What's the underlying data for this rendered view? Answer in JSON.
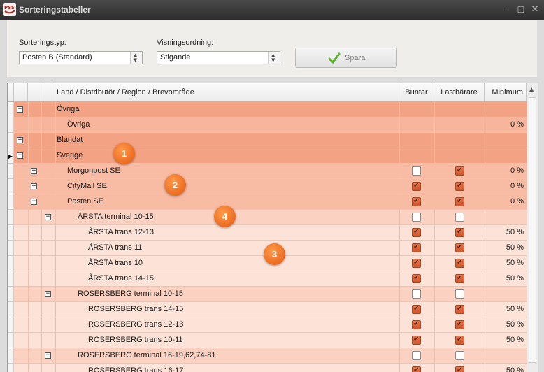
{
  "window": {
    "title": "Sorteringstabeller",
    "app_icon_text": "PSS"
  },
  "toolbar": {
    "sort_type_label": "Sorteringstyp:",
    "sort_type_value": "Posten B (Standard)",
    "order_label": "Visningsordning:",
    "order_value": "Stigande",
    "save_label": "Spara"
  },
  "grid": {
    "columns": [
      "Land / Distributör / Region / Brevområde",
      "Buntar",
      "Lastbärare",
      "Minimum"
    ],
    "rows": [
      {
        "label": "Övriga",
        "level": 1,
        "toggle": "−",
        "group": "g1",
        "buntar": null,
        "lastbarare": null,
        "minimum": ""
      },
      {
        "label": "Övriga",
        "level": 2,
        "toggle": "",
        "group": "g1b",
        "buntar": null,
        "lastbarare": null,
        "minimum": "0 %"
      },
      {
        "label": "Blandat",
        "level": 1,
        "toggle": "+",
        "group": "g1",
        "buntar": null,
        "lastbarare": null,
        "minimum": ""
      },
      {
        "label": "Sverige",
        "level": 1,
        "toggle": "−",
        "group": "g1",
        "buntar": null,
        "lastbarare": null,
        "minimum": "",
        "current": true
      },
      {
        "label": "Morgonpost SE",
        "level": 2,
        "toggle": "+",
        "group": "g2",
        "buntar": false,
        "lastbarare": true,
        "minimum": "0 %"
      },
      {
        "label": "CityMail SE",
        "level": 2,
        "toggle": "+",
        "group": "g2",
        "buntar": true,
        "lastbarare": true,
        "minimum": "0 %"
      },
      {
        "label": "Posten SE",
        "level": 2,
        "toggle": "−",
        "group": "g2",
        "buntar": true,
        "lastbarare": true,
        "minimum": "0 %"
      },
      {
        "label": "ÅRSTA terminal 10-15",
        "level": 3,
        "toggle": "−",
        "group": "g3",
        "buntar": false,
        "lastbarare": false,
        "minimum": ""
      },
      {
        "label": "ÅRSTA trans 12-13",
        "level": 4,
        "toggle": "",
        "group": "g4",
        "buntar": true,
        "lastbarare": true,
        "minimum": "50 %"
      },
      {
        "label": "ÅRSTA trans 11",
        "level": 4,
        "toggle": "",
        "group": "g4",
        "buntar": true,
        "lastbarare": true,
        "minimum": "50 %"
      },
      {
        "label": "ÅRSTA trans 10",
        "level": 4,
        "toggle": "",
        "group": "g4",
        "buntar": true,
        "lastbarare": true,
        "minimum": "50 %"
      },
      {
        "label": "ÅRSTA trans 14-15",
        "level": 4,
        "toggle": "",
        "group": "g4",
        "buntar": true,
        "lastbarare": true,
        "minimum": "50 %"
      },
      {
        "label": "ROSERSBERG terminal 10-15",
        "level": 3,
        "toggle": "−",
        "group": "g3",
        "buntar": false,
        "lastbarare": false,
        "minimum": ""
      },
      {
        "label": "ROSERSBERG trans 14-15",
        "level": 4,
        "toggle": "",
        "group": "g4",
        "buntar": true,
        "lastbarare": true,
        "minimum": "50 %"
      },
      {
        "label": "ROSERSBERG trans 12-13",
        "level": 4,
        "toggle": "",
        "group": "g4",
        "buntar": true,
        "lastbarare": true,
        "minimum": "50 %"
      },
      {
        "label": "ROSERSBERG trans 10-11",
        "level": 4,
        "toggle": "",
        "group": "g4",
        "buntar": true,
        "lastbarare": true,
        "minimum": "50 %"
      },
      {
        "label": "ROSERSBERG terminal 16-19,62,74-81",
        "level": 3,
        "toggle": "−",
        "group": "g3",
        "buntar": false,
        "lastbarare": false,
        "minimum": ""
      },
      {
        "label": "ROSERSBERG trans 16-17",
        "level": 4,
        "toggle": "",
        "group": "g4",
        "buntar": true,
        "lastbarare": true,
        "minimum": "50 %"
      }
    ]
  },
  "annotations": [
    "1",
    "2",
    "3",
    "4"
  ],
  "colors": {
    "g1": "#f4a284",
    "g1b": "#f7b59c",
    "g2": "#f8bba3",
    "g3": "#fbd2c1",
    "g4": "#fde3d7",
    "accent_check": "#d95a2e",
    "save_check": "#5cb531"
  }
}
